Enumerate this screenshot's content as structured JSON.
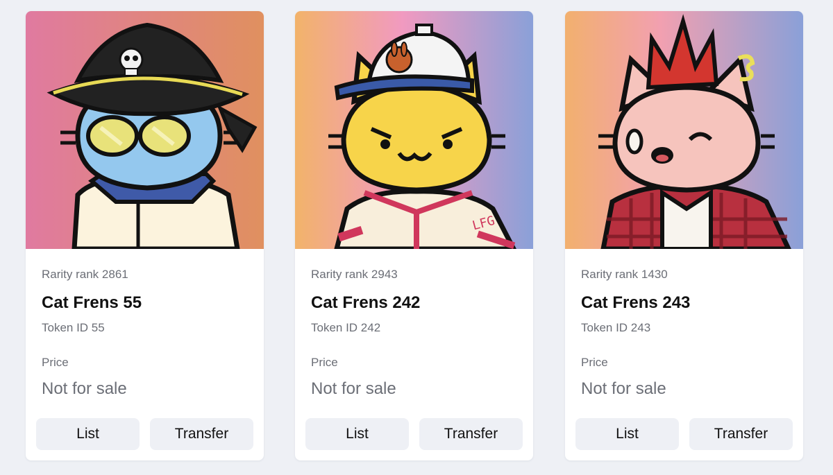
{
  "cards": [
    {
      "rarity": "Rarity rank 2861",
      "name": "Cat Frens 55",
      "token": "Token ID 55",
      "price_label": "Price",
      "price_value": "Not for sale",
      "list_label": "List",
      "transfer_label": "Transfer",
      "art": {
        "bg_from": "#e07aa0",
        "bg_to": "#e0905f",
        "cat_color": "#94c8ee",
        "accessory": "pirate-hat-sunglasses"
      }
    },
    {
      "rarity": "Rarity rank 2943",
      "name": "Cat Frens 242",
      "token": "Token ID 242",
      "price_label": "Price",
      "price_value": "Not for sale",
      "list_label": "List",
      "transfer_label": "Transfer",
      "art": {
        "bg_from": "#f2b36a",
        "bg_to": "#8aa0d8",
        "cat_color": "#f7d44a",
        "accessory": "cap-baseball-jersey",
        "jersey_text": "LFG"
      }
    },
    {
      "rarity": "Rarity rank 1430",
      "name": "Cat Frens 243",
      "token": "Token ID 243",
      "price_label": "Price",
      "price_value": "Not for sale",
      "list_label": "List",
      "transfer_label": "Transfer",
      "art": {
        "bg_from": "#f2b06e",
        "bg_to": "#8aa0d8",
        "cat_color": "#f6c4bd",
        "accessory": "mohawk-flannel"
      }
    }
  ]
}
